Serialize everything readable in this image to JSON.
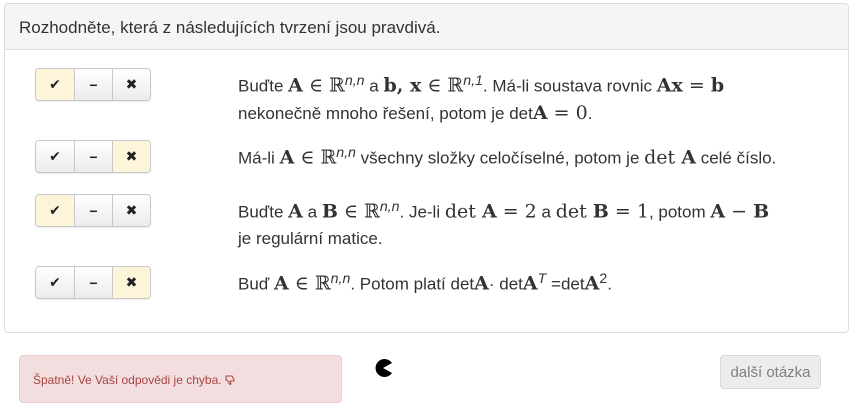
{
  "header": {
    "title": "Rozhodněte, která z následujících tvrzení jsou pravdivá."
  },
  "buttons": {
    "true": "✔",
    "neutral": "−",
    "false": "✖"
  },
  "statements": [
    {
      "selected": "true",
      "p1": "Buďte ",
      "m1": "A",
      "m2": " ∈ ℝ",
      "s1": "n,n",
      "p2": " a ",
      "m3": "b, x",
      "m4": " ∈ ℝ",
      "s2": "n,1",
      "p3": ". Má-li soustava rovnic ",
      "m5": "Ax",
      "m6": " = ",
      "m7": "b",
      "p4": "nekonečně mnoho řešení, potom je det",
      "m8": "A",
      "m9": " = 0",
      "p5": "."
    },
    {
      "selected": "false",
      "p1": "Má-li ",
      "m1": "A",
      "m2": " ∈ ℝ",
      "s1": "n,n",
      "p2": " všechny složky celočíselné, potom je ",
      "m3": "det ",
      "m4": "A",
      "p3": " celé číslo."
    },
    {
      "selected": "true",
      "p1": "Buďte ",
      "m1": "A",
      "p2": " a ",
      "m2": "B",
      "m3": " ∈ ℝ",
      "s1": "n,n",
      "p3": ". Je-li ",
      "m4": "det ",
      "m5": "A",
      "m6": " = 2",
      "p4": " a ",
      "m7": "det ",
      "m8": "B",
      "m9": " = 1",
      "p5": ", potom ",
      "m10": "A",
      "m11": " − ",
      "m12": "B",
      "p6": "je regulární matice."
    },
    {
      "selected": "false",
      "p1": "Buď ",
      "m1": "A",
      "m2": " ∈ ℝ",
      "s1": "n,n",
      "p2": ". Potom platí det",
      "m3": "A",
      "p3": "· det",
      "m4": "A",
      "s2": "T",
      "p4": " =det",
      "m5": "A",
      "s3": "2",
      "p5": "."
    }
  ],
  "feedback": {
    "text": "Špatně! Ve Vaší odpovědi je chyba.",
    "icon": "thumbs-down-icon"
  },
  "next_button": {
    "label": "další otázka"
  },
  "colors": {
    "active_button": "#fdf5d9",
    "feedback_bg": "#f2dede",
    "feedback_text": "#a94442"
  }
}
